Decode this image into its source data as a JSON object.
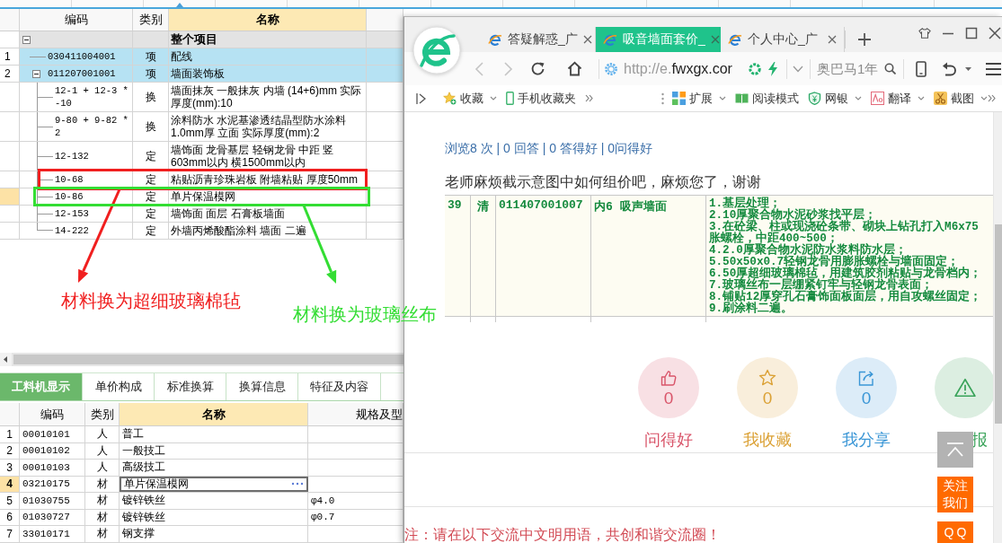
{
  "project_table": {
    "columns": [
      {
        "label": "编码",
        "highlighted": false
      },
      {
        "label": "类别",
        "highlighted": false
      },
      {
        "label": "名称",
        "highlighted": true
      }
    ],
    "tree": {
      "name": "整个项目",
      "expanded": true,
      "children": [
        {
          "number": "1",
          "code": "030411004001",
          "type": "项",
          "name": "配线",
          "kind": "item",
          "selected": false
        },
        {
          "number": "2",
          "code": "011207001001",
          "type": "项",
          "name": "墙面装饰板",
          "kind": "item",
          "selected": false,
          "expanded": true,
          "children": [
            {
              "code": "12-1 + 12-3 * -10",
              "type": "换",
              "name": "墙面抹灰 一般抹灰 内墙 (14+6)mm 实际厚度(mm):10",
              "kind": "quota",
              "selected": false
            },
            {
              "code": "9-80 + 9-82 * 2",
              "type": "换",
              "name": "涂料防水 水泥基渗透结晶型防水涂料 1.0mm厚 立面 实际厚度(mm):2",
              "kind": "quota",
              "selected": false
            },
            {
              "code": "12-132",
              "type": "定",
              "name": "墙饰面 龙骨基层 轻钢龙骨 中距 竖 603mm以内 横1500mm以内",
              "kind": "quota",
              "selected": false
            },
            {
              "code": "10-68",
              "type": "定",
              "name": "粘贴沥青珍珠岩板 附墙粘贴 厚度50mm",
              "kind": "quota",
              "selected": false
            },
            {
              "code": "10-86",
              "type": "定",
              "name": "单片保温模网",
              "kind": "quota",
              "selected": true
            },
            {
              "code": "12-153",
              "type": "定",
              "name": "墙饰面 面层 石膏板墙面",
              "kind": "quota",
              "selected": false
            },
            {
              "code": "14-222",
              "type": "定",
              "name": "外墙丙烯酸酯涂料 墙面 二遍",
              "kind": "quota",
              "selected": false
            }
          ]
        }
      ]
    }
  },
  "annotations": [
    {
      "text": "材料换为超细玻璃棉毡",
      "color": "#f01f1f"
    },
    {
      "text": "材料换为玻璃丝布",
      "color": "#33dd33"
    }
  ],
  "detail_tabs": [
    {
      "label": "工料机显示",
      "selected": true
    },
    {
      "label": "单价构成",
      "selected": false
    },
    {
      "label": "标准换算",
      "selected": false
    },
    {
      "label": "换算信息",
      "selected": false
    },
    {
      "label": "特征及内容",
      "selected": false
    }
  ],
  "resource_table": {
    "columns": [
      {
        "label": "编码",
        "highlighted": false
      },
      {
        "label": "类别",
        "highlighted": false
      },
      {
        "label": "名称",
        "highlighted": true
      },
      {
        "label": "规格及型",
        "highlighted": false
      }
    ],
    "rows": [
      {
        "number": "1",
        "code": "00010101",
        "type": "人",
        "name": "普工",
        "selected": false
      },
      {
        "number": "2",
        "code": "00010102",
        "type": "人",
        "name": "一般技工",
        "selected": false
      },
      {
        "number": "3",
        "code": "00010103",
        "type": "人",
        "name": "高级技工",
        "selected": false
      },
      {
        "number": "4",
        "code": "03210175",
        "type": "材",
        "name": "单片保温模网",
        "selected": true
      },
      {
        "number": "5",
        "code": "01030755",
        "type": "材",
        "name": "镀锌铁丝",
        "spec": "φ4.0",
        "selected": false
      },
      {
        "number": "6",
        "code": "01030727",
        "type": "材",
        "name": "镀锌铁丝",
        "spec": "φ0.7",
        "selected": false
      },
      {
        "number": "7",
        "code": "33010171",
        "type": "材",
        "name": "钢支撑",
        "selected": false
      }
    ]
  },
  "browser": {
    "tabs": [
      {
        "title": "答疑解惑_广",
        "selected": false
      },
      {
        "title": "吸音墙面套价_",
        "selected": true
      },
      {
        "title": "个人中心_广",
        "selected": false
      }
    ],
    "url": {
      "scheme": "http://e.",
      "host": "fwxgx.cor"
    },
    "search": {
      "placeholder": "奥巴马1年"
    },
    "favorites": [
      {
        "label": "收藏",
        "dropdown": true
      },
      {
        "label": "手机收藏夹",
        "dropdown": false
      }
    ],
    "tools": [
      {
        "label": "扩展",
        "dropdown": true
      },
      {
        "label": "阅读模式",
        "dropdown": false
      },
      {
        "label": "网银",
        "dropdown": true
      },
      {
        "label": "翻译",
        "dropdown": true
      },
      {
        "label": "截图",
        "dropdown": true
      }
    ]
  },
  "page": {
    "stats": "浏览8 次 | 0 回答 | 0 答得好 | 0问得好",
    "question": "老师麻烦截示意图中如何组价吧，麻烦您了，谢谢",
    "attachment": {
      "number": "39",
      "type": "清",
      "code": "011407001007",
      "name": "内6 吸声墙面",
      "feature_lines": [
        "1.基层处理；",
        "2.10厚聚合物水泥砂浆找平层；",
        "3.在砼梁、柱或现浇砼条带、砌块上钻孔打入M6x75",
        "胀螺栓，中距400~500；",
        "4.2.0厚聚合物水泥防水浆料防水层；",
        "5.50x50x0.7轻钢龙骨用膨胀螺栓与墙面固定；",
        "6.50厚超细玻璃棉毡，用建筑胶剂粘贴与龙骨档内；",
        "7.玻璃丝布一层绷紧钉牢与轻钢龙骨表面；",
        "8.铺贴12厚穿孔石膏饰面板面层，用自攻螺丝固定；",
        "9.刷涂料二遍。"
      ]
    },
    "actions": [
      {
        "kind": "like",
        "count": "0",
        "label": "问得好",
        "color": "#d9556a"
      },
      {
        "kind": "favorite",
        "count": "0",
        "label": "我收藏",
        "color": "#dba135"
      },
      {
        "kind": "share",
        "count": "0",
        "label": "我分享",
        "color": "#3a96d6"
      },
      {
        "kind": "report",
        "label": "报",
        "color": "#3aa35a"
      }
    ],
    "side_buttons": [
      {
        "kind": "top"
      },
      {
        "kind": "follow",
        "label": "关注我们"
      },
      {
        "kind": "qq",
        "label": "QQ"
      }
    ],
    "notice": "注：请在以下交流中文明用语，共创和谐交流圈！"
  }
}
